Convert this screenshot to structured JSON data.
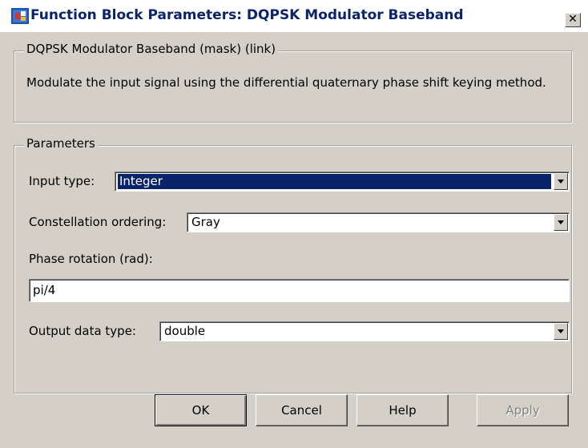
{
  "window": {
    "title": "Function Block Parameters: DQPSK Modulator Baseband",
    "close_glyph": "✕"
  },
  "block": {
    "heading": "DQPSK Modulator Baseband (mask) (link)",
    "description": "Modulate the input signal using the differential quaternary phase shift keying method."
  },
  "parameters": {
    "heading": "Parameters",
    "input_type": {
      "label": "Input type:",
      "value": "Integer"
    },
    "constellation_ordering": {
      "label": "Constellation ordering:",
      "value": "Gray"
    },
    "phase_rotation": {
      "label": "Phase rotation (rad):",
      "value": "pi/4"
    },
    "output_data_type": {
      "label": "Output data type:",
      "value": "double"
    }
  },
  "buttons": {
    "ok": "OK",
    "cancel": "Cancel",
    "help": "Help",
    "apply": "Apply"
  },
  "colors": {
    "title_text": "#0a246a",
    "selection": "#0a246a",
    "face": "#d4d0c8"
  },
  "icons": {
    "app": "simulink-block-icon",
    "close": "close-icon",
    "dropdown": "chevron-down-icon"
  }
}
